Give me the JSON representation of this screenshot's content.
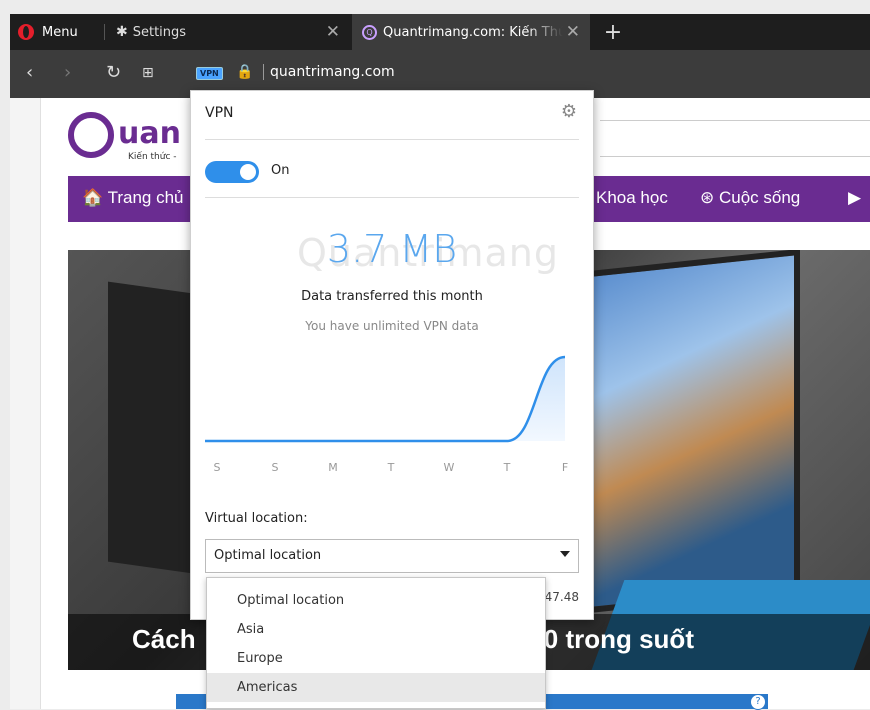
{
  "browser": {
    "menu_label": "Menu",
    "tabs": [
      {
        "label": "Settings",
        "close": "✕"
      },
      {
        "label": "Quantrimang.com: Kiến Thức",
        "close": "✕"
      }
    ],
    "new_tab": "+",
    "address": {
      "vpn_badge": "VPN",
      "url": "quantrimang.com"
    }
  },
  "website": {
    "logo_text": "uan",
    "logo_sub": "Kiến thức -",
    "nav": [
      "Trang chủ",
      "Khoa học",
      "Cuộc sống"
    ],
    "hero_caption": "Cách                                    dows 10 trong suốt",
    "ad_info": "?"
  },
  "vpn": {
    "title": "VPN",
    "toggle_label": "On",
    "toggle_on": true,
    "data_amount": "3.7 MB",
    "data_label": "Data transferred this month",
    "data_sub": "You have unlimited VPN data",
    "days": [
      "S",
      "S",
      "M",
      "T",
      "W",
      "T",
      "F"
    ],
    "usage_values": [
      0,
      0,
      0,
      0,
      0,
      0,
      3.7
    ],
    "location_label": "Virtual location:",
    "location_value": "Optimal location",
    "ip_partial": "47.48",
    "options": [
      "Optimal location",
      "Asia",
      "Europe",
      "Americas"
    ],
    "hovered_option": "Americas",
    "accent_color": "#2f8fea"
  },
  "watermark": "Quantrimang"
}
